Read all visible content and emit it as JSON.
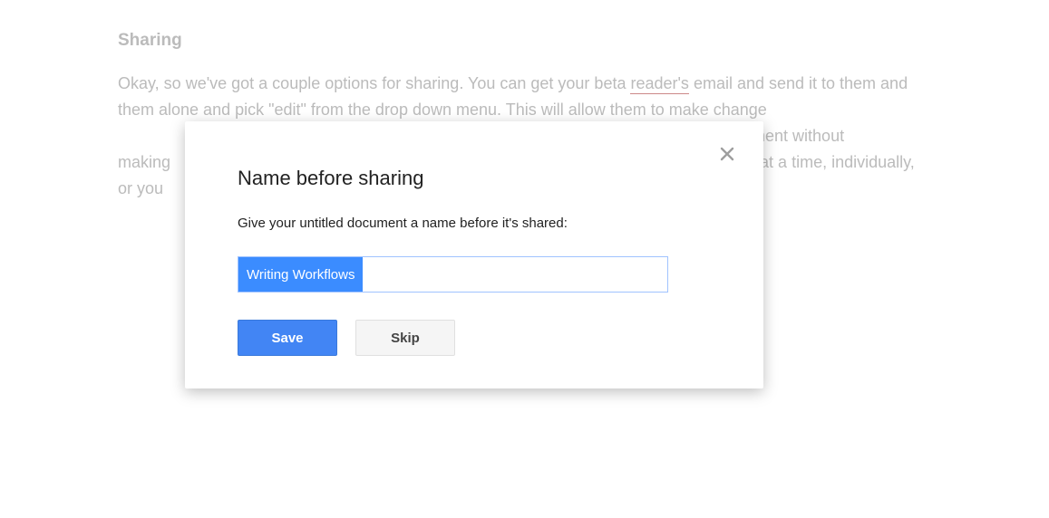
{
  "background": {
    "heading": "Sharing",
    "text_before_underline": "Okay, so we've got a couple options for sharing. You can get your beta ",
    "underlined_fragment": "reader's",
    "text_after_underline": " email and send it to them and them alone and pick \"edit\" from the drop down menu. This will allow them to make change",
    "fragment_right_1": "nd comment without",
    "fragment_line2_left": "making",
    "fragment_line2_right": " at a time, individually,",
    "fragment_line3": "or you "
  },
  "dialog": {
    "title": "Name before sharing",
    "instruction": "Give your untitled document a name before it's shared:",
    "input_value": "Writing Workflows",
    "save_label": "Save",
    "skip_label": "Skip"
  }
}
